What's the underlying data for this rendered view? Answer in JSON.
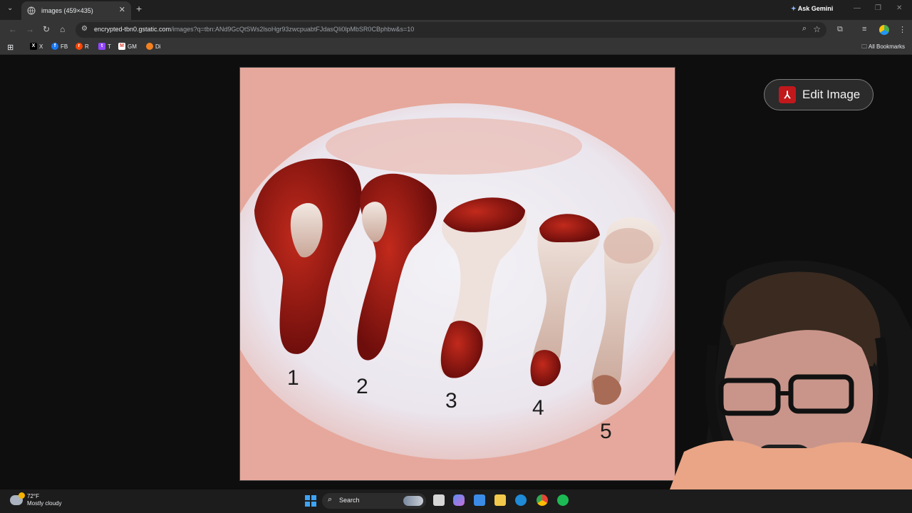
{
  "browser": {
    "tab": {
      "title": "images (459×435)",
      "close_glyph": "✕",
      "favicon": "globe-icon"
    },
    "new_tab_glyph": "+",
    "tab_search_glyph": "⌄",
    "ask_gemini": "Ask Gemini",
    "window_controls": {
      "minimize": "—",
      "restore": "❐",
      "close": "✕"
    },
    "nav": {
      "back": "←",
      "forward": "→",
      "reload": "↻",
      "home": "⌂"
    },
    "url": {
      "host": "encrypted-tbn0.gstatic.com",
      "path": "/images?q=tbn:ANd9GcQtSWs2lsoHgr93zwcpuabtFJdasQIi0lpMbSR0CBphbw&s=10"
    },
    "omnibox_icons": {
      "site_info": "⚙",
      "zoom": "⌕",
      "bookmark_star": "☆"
    },
    "toolbar_icons": {
      "extensions": "⧉",
      "media": "≡",
      "menu": "⋮"
    },
    "bookmarks": [
      {
        "label": "X",
        "icon": "x-icon",
        "color": "#000000",
        "glyph": "X"
      },
      {
        "label": "FB",
        "icon": "facebook-icon",
        "color": "#1877f2",
        "glyph": "f"
      },
      {
        "label": "R",
        "icon": "reddit-icon",
        "color": "#ff4500",
        "glyph": "r"
      },
      {
        "label": "T",
        "icon": "twitch-icon",
        "color": "#9146ff",
        "glyph": "t"
      },
      {
        "label": "GM",
        "icon": "gmail-icon",
        "color": "#ea4335",
        "glyph": "M"
      },
      {
        "label": "Di",
        "icon": "orange-circle-icon",
        "color": "#f48120",
        "glyph": ""
      }
    ],
    "apps_glyph": "⊞",
    "all_bookmarks": "All Bookmarks"
  },
  "image": {
    "labels": [
      "1",
      "2",
      "3",
      "4",
      "5"
    ]
  },
  "edit_button": {
    "label": "Edit Image",
    "icon": "adobe-acrobat-icon",
    "glyph": "⅄"
  },
  "taskbar": {
    "weather": {
      "temp": "72°F",
      "condition": "Mostly cloudy"
    },
    "search_label": "Search",
    "search_glyph": "⌕",
    "apps": [
      {
        "name": "task-view-icon",
        "color": "#d6d6d6"
      },
      {
        "name": "copilot-icon",
        "color": "#5b8def"
      },
      {
        "name": "store-icon",
        "color": "#3c8ce7"
      },
      {
        "name": "file-explorer-icon",
        "color": "#f2c94c"
      },
      {
        "name": "edge-icon",
        "color": "#1f8ad6"
      },
      {
        "name": "chrome-icon",
        "color": "#34a853"
      },
      {
        "name": "spotify-icon",
        "color": "#1db954"
      }
    ]
  }
}
